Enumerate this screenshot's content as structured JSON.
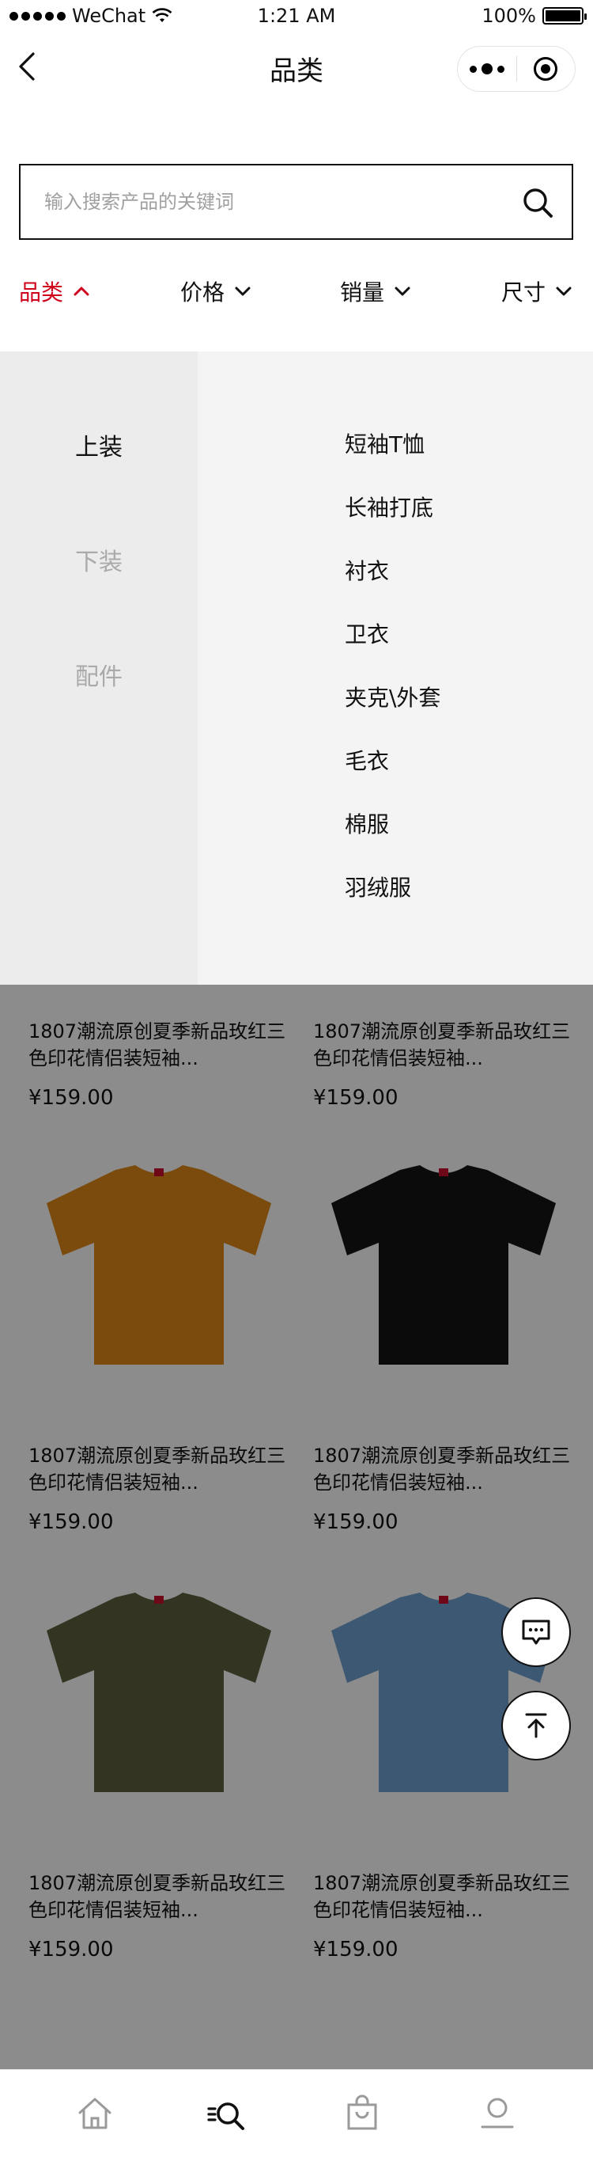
{
  "status_bar": {
    "carrier": "WeChat",
    "time": "1:21 AM",
    "battery": "100%",
    "battery_level": 1.0
  },
  "nav": {
    "title": "品类"
  },
  "search": {
    "placeholder": "输入搜索产品的关键词",
    "value": ""
  },
  "filters": [
    {
      "label": "品类",
      "active": true,
      "icon": "chevron-up-icon"
    },
    {
      "label": "价格",
      "active": false,
      "icon": "chevron-down-icon"
    },
    {
      "label": "销量",
      "active": false,
      "icon": "chevron-down-icon"
    },
    {
      "label": "尺寸",
      "active": false,
      "icon": "chevron-down-icon"
    }
  ],
  "dropdown": {
    "categories": [
      {
        "label": "上装",
        "selected": true
      },
      {
        "label": "下装",
        "selected": false
      },
      {
        "label": "配件",
        "selected": false
      }
    ],
    "subcategories": [
      "短袖T恤",
      "长袖打底",
      "衬衣",
      "卫衣",
      "夹克\\外套",
      "毛衣",
      "棉服",
      "羽绒服"
    ]
  },
  "products": [
    {
      "title": "1807潮流原创夏季新品玫红三色印花情侣装短袖...",
      "price": "¥159.00",
      "shirt_color": "#8a9a86"
    },
    {
      "title": "1807潮流原创夏季新品玫红三色印花情侣装短袖...",
      "price": "¥159.00",
      "shirt_color": "#6b5a4e"
    },
    {
      "title": "1807潮流原创夏季新品玫红三色印花情侣装短袖...",
      "price": "¥159.00",
      "shirt_color": "#e08718"
    },
    {
      "title": "1807潮流原创夏季新品玫红三色印花情侣装短袖...",
      "price": "¥159.00",
      "shirt_color": "#151515"
    },
    {
      "title": "1807潮流原创夏季新品玫红三色印花情侣装短袖...",
      "price": "¥159.00",
      "shirt_color": "#5d5f3e"
    },
    {
      "title": "1807潮流原创夏季新品玫红三色印花情侣装短袖...",
      "price": "¥159.00",
      "shirt_color": "#6fa1cf"
    }
  ],
  "floating": {
    "chat_icon": "chat-icon",
    "top_icon": "back-to-top-icon"
  },
  "tabbar": [
    {
      "icon": "home-icon",
      "active": false
    },
    {
      "icon": "category-search-icon",
      "active": true
    },
    {
      "icon": "cart-bag-icon",
      "active": false
    },
    {
      "icon": "profile-icon",
      "active": false
    }
  ],
  "colors": {
    "accent": "#d0021b",
    "mask": "rgba(0,0,0,0.45)",
    "dropdown_bg": "#f4f4f4",
    "dropdown_left_bg": "#ececec"
  }
}
